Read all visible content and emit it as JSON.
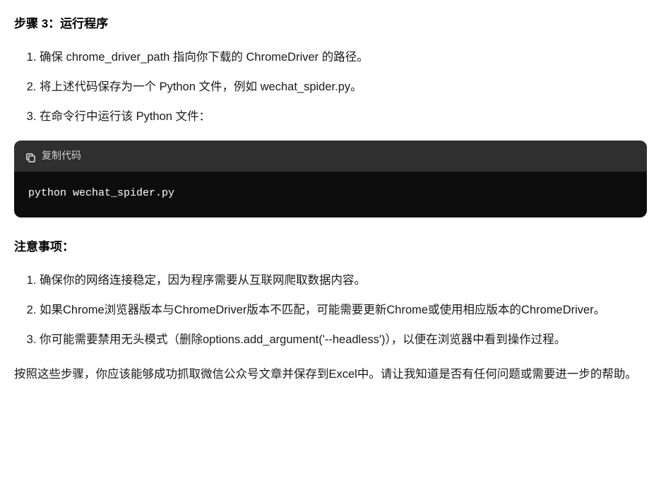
{
  "step3": {
    "heading": "步骤 3：运行程序",
    "items": [
      "确保 chrome_driver_path 指向你下载的 ChromeDriver 的路径。",
      "将上述代码保存为一个 Python 文件，例如 wechat_spider.py。",
      "在命令行中运行该 Python 文件："
    ]
  },
  "code": {
    "copy_label": "复制代码",
    "content": "python wechat_spider.py"
  },
  "notes": {
    "heading": "注意事项：",
    "items": [
      "确保你的网络连接稳定，因为程序需要从互联网爬取数据内容。",
      "如果Chrome浏览器版本与ChromeDriver版本不匹配，可能需要更新Chrome或使用相应版本的ChromeDriver。",
      "你可能需要禁用无头模式（删除options.add_argument('--headless')），以便在浏览器中看到操作过程。"
    ]
  },
  "closing": "按照这些步骤，你应该能够成功抓取微信公众号文章并保存到Excel中。请让我知道是否有任何问题或需要进一步的帮助。"
}
